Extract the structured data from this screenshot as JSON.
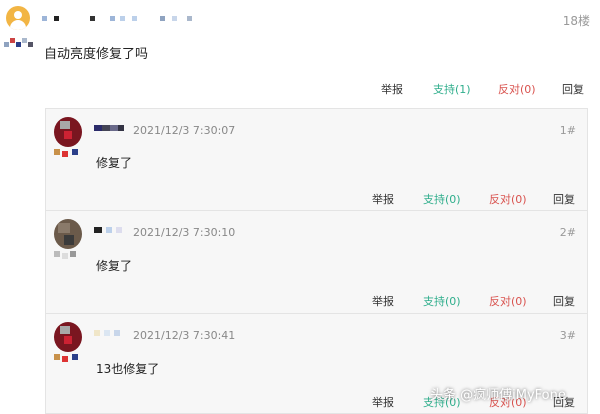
{
  "post": {
    "floor": "18楼",
    "content": "自动亮度修复了吗",
    "actions": {
      "report": "举报",
      "support": "支持(1)",
      "oppose": "反对(0)",
      "reply": "回复"
    }
  },
  "replies": [
    {
      "timestamp": "2021/12/3 7:30:07",
      "floor": "1#",
      "content": "修复了",
      "actions": {
        "report": "举报",
        "support": "支持(0)",
        "oppose": "反对(0)",
        "reply": "回复"
      }
    },
    {
      "timestamp": "2021/12/3 7:30:10",
      "floor": "2#",
      "content": "修复了",
      "actions": {
        "report": "举报",
        "support": "支持(0)",
        "oppose": "反对(0)",
        "reply": "回复"
      }
    },
    {
      "timestamp": "2021/12/3 7:30:41",
      "floor": "3#",
      "content": "13也修复了",
      "actions": {
        "report": "举报",
        "support": "支持(0)",
        "oppose": "反对(0)",
        "reply": "回复"
      }
    }
  ],
  "watermark": "头条 @疯师傅iMyFone",
  "colors": {
    "support": "#2fae8c",
    "oppose": "#d9534f",
    "avatar_default": "#f2b544",
    "reply_background": "#f7f7f7"
  }
}
